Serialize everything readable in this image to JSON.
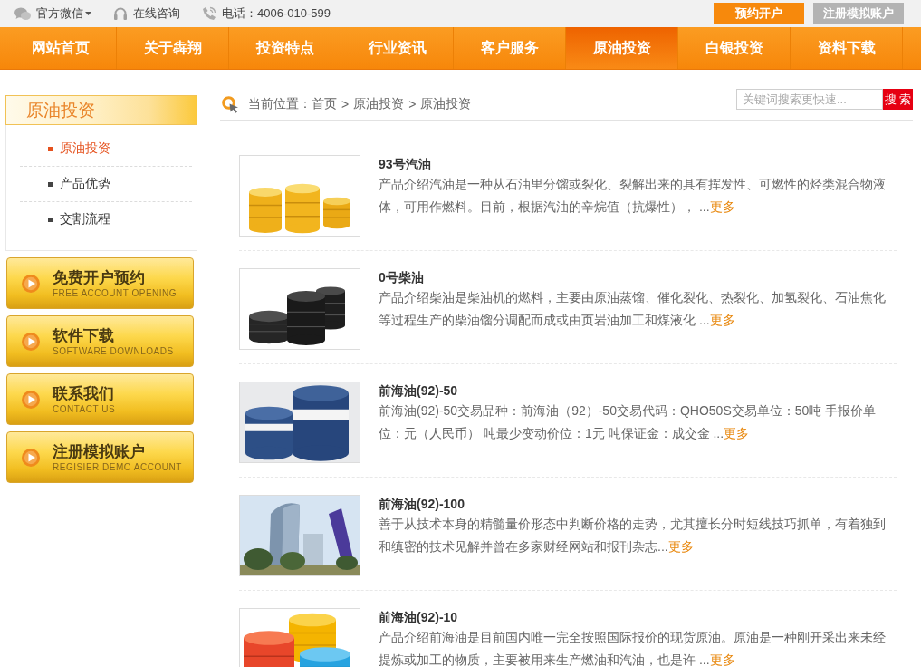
{
  "top_bar": {
    "links": [
      {
        "label": "官方微信",
        "dropdown": true
      },
      {
        "label": "在线咨询",
        "dropdown": false
      },
      {
        "label": "电话：4006-010-599",
        "dropdown": false
      }
    ],
    "buttons": [
      {
        "label": "预约开户",
        "kind": "primary"
      },
      {
        "label": "注册模拟账户",
        "kind": "secondary"
      }
    ]
  },
  "nav": [
    {
      "label": "网站首页",
      "selected": false
    },
    {
      "label": "关于犇翔",
      "selected": false
    },
    {
      "label": "投资特点",
      "selected": false
    },
    {
      "label": "行业资讯",
      "selected": false
    },
    {
      "label": "客户服务",
      "selected": false
    },
    {
      "label": "原油投资",
      "selected": true
    },
    {
      "label": "白银投资",
      "selected": false
    },
    {
      "label": "资料下载",
      "selected": false
    }
  ],
  "sidebar": {
    "title": "原油投资",
    "items": [
      {
        "label": "原油投资",
        "selected": true
      },
      {
        "label": "产品优势",
        "selected": false
      },
      {
        "label": "交割流程",
        "selected": false
      }
    ]
  },
  "side_buttons": [
    {
      "title": "免费开户预约",
      "subtitle": "FREE ACCOUNT OPENING"
    },
    {
      "title": "软件下载",
      "subtitle": "SOFTWARE DOWNLOADS"
    },
    {
      "title": "联系我们",
      "subtitle": "CONTACT US"
    },
    {
      "title": "注册模拟账户",
      "subtitle": "REGISIER DEMO ACCOUNT"
    }
  ],
  "breadcrumb": {
    "label": "当前位置：",
    "separator": ">",
    "items": [
      "首页",
      "原油投资",
      "原油投资"
    ]
  },
  "search": {
    "placeholder": "关键词搜索更快速...",
    "button": "搜 索"
  },
  "articles": [
    {
      "title": "93号汽油",
      "description": "产品介绍汽油是一种从石油里分馏或裂化、裂解出来的具有挥发性、可燃性的烃类混合物液体，可用作燃料。目前，根据汽油的辛烷值（抗爆性）， ...",
      "more": "更多"
    },
    {
      "title": "0号柴油",
      "description": "产品介绍柴油是柴油机的燃料，主要由原油蒸馏、催化裂化、热裂化、加氢裂化、石油焦化等过程生产的柴油馏分调配而成或由页岩油加工和煤液化 ...",
      "more": "更多"
    },
    {
      "title": "前海油(92)-50",
      "description": "前海油(92)-50交易品种：前海油（92）-50交易代码：QHO50S交易单位：50吨 手报价单位：元（人民币） 吨最少变动价位：1元 吨保证金：成交金 ...",
      "more": "更多"
    },
    {
      "title": "前海油(92)-100",
      "description": "善于从技术本身的精髓量价形态中判断价格的走势，尤其擅长分时短线技巧抓单，有着独到和缜密的技术见解并曾在多家财经网站和报刊杂志...",
      "more": "更多"
    },
    {
      "title": "前海油(92)-10",
      "description": "产品介绍前海油是目前国内唯一完全按照国际报价的现货原油。原油是一种刚开采出来未经提炼或加工的物质，主要被用来生产燃油和汽油，也是许 ...",
      "more": "更多"
    }
  ]
}
